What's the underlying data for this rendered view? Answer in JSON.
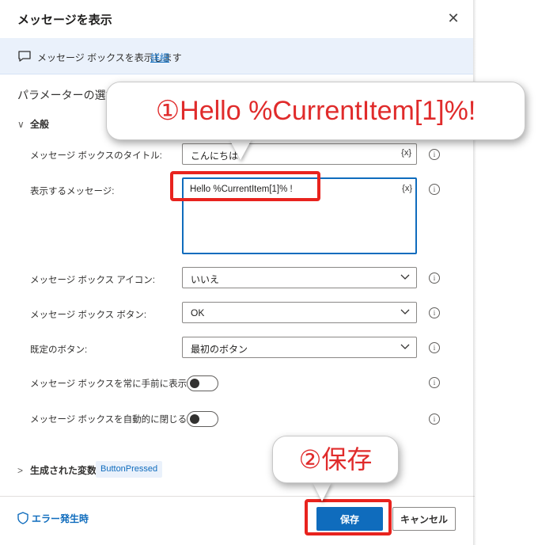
{
  "dialog": {
    "title": "メッセージを表示",
    "close_glyph": "✕"
  },
  "banner": {
    "text": "メッセージ ボックスを表示します",
    "link": "詳細"
  },
  "params_heading": "パラメーターの選択",
  "section": {
    "label": "全般",
    "chevron": "∨"
  },
  "fields": {
    "title_label": "メッセージ ボックスのタイトル:",
    "title_value": "こんにちは",
    "message_label": "表示するメッセージ:",
    "message_value": "Hello %CurrentItem[1]% !",
    "icon_label": "メッセージ ボックス アイコン:",
    "icon_value": "いいえ",
    "buttons_label": "メッセージ ボックス ボタン:",
    "buttons_value": "OK",
    "default_label": "既定のボタン:",
    "default_value": "最初のボタン",
    "ontop_label": "メッセージ ボックスを常に手前に表示する:",
    "autoclose_label": "メッセージ ボックスを自動的に閉じる:",
    "var_glyph": "{x}",
    "info_glyph": "i"
  },
  "toggles": {
    "ontop_on": false,
    "autoclose_on": false
  },
  "variables": {
    "chevron": ">",
    "label": "生成された変数",
    "badge": "ButtonPressed"
  },
  "footer": {
    "error_link": "エラー発生時",
    "save": "保存",
    "cancel": "キャンセル"
  },
  "annotations": {
    "callout1": "①Hello %CurrentItem[1]%!",
    "callout2": "②保存"
  },
  "colors": {
    "accent": "#0f6cbd",
    "annotation_red": "#e02b2b",
    "banner_bg": "#eaf1fb"
  }
}
